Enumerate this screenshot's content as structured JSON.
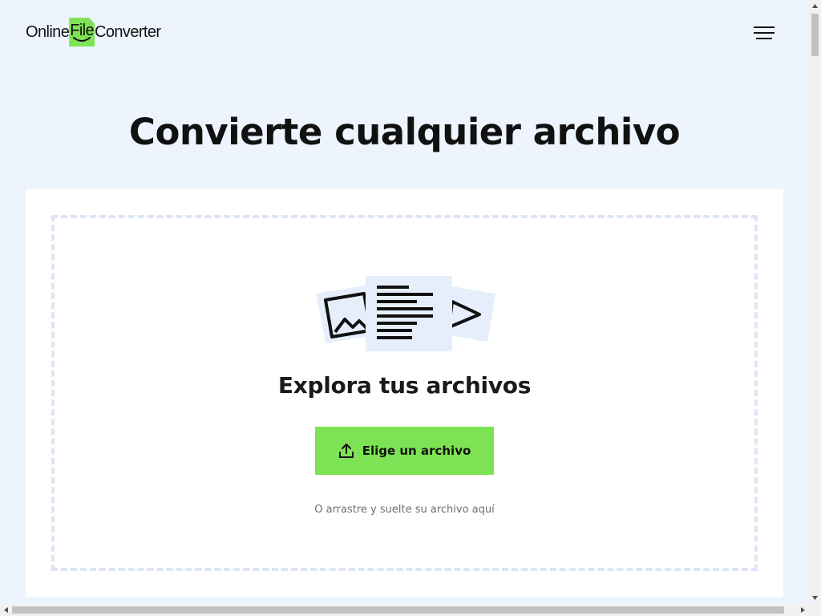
{
  "header": {
    "logo": {
      "left": "Online",
      "middle": "File",
      "right": "Converter"
    },
    "menu_icon": "hamburger-menu-icon"
  },
  "hero": {
    "title": "Convierte cualquier archivo"
  },
  "upload": {
    "illustration_icon": "file-types-illustration",
    "heading": "Explora tus archivos",
    "button_label": "Elige un archivo",
    "button_icon": "upload-icon",
    "hint": "O arrastre y suelte su archivo aquí"
  },
  "colors": {
    "accent": "#7ee354",
    "background": "#eef4fd",
    "card": "#ffffff",
    "dropzone_border": "#dde6f6",
    "text": "#111111",
    "muted_text": "#6f6f6f"
  }
}
